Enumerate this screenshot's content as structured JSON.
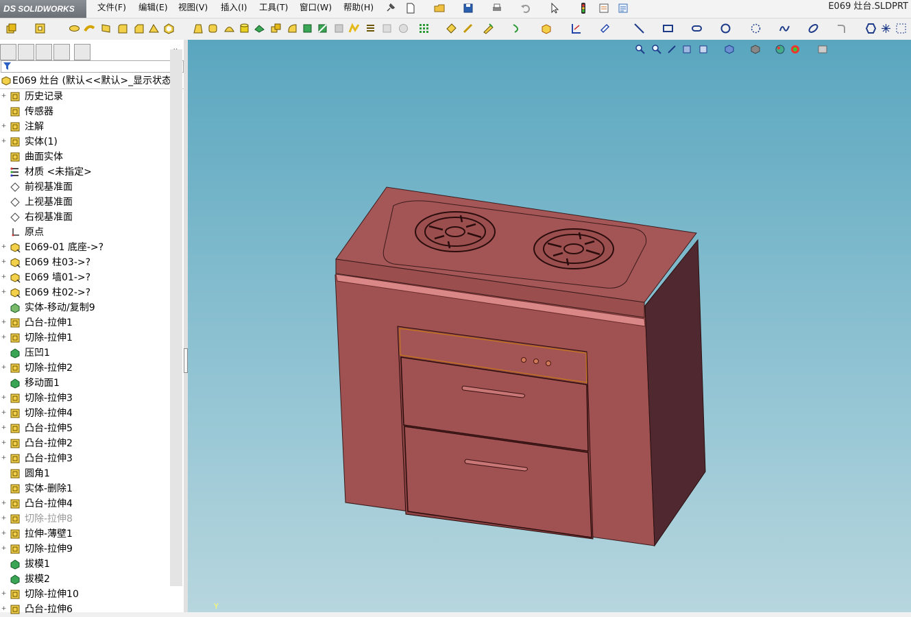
{
  "app": {
    "logo_text": "SOLIDWORKS",
    "logo_prefix": "DS",
    "filename": "E069 灶台.SLDPRT"
  },
  "menu": [
    "文件(F)",
    "编辑(E)",
    "视图(V)",
    "插入(I)",
    "工具(T)",
    "窗口(W)",
    "帮助(H)"
  ],
  "panel": {
    "tab_icons": [
      "feature-manager-icon",
      "property-manager-icon",
      "configuration-manager-icon",
      "dimxpert-icon",
      "display-manager-icon"
    ],
    "collapse_label": "»",
    "root_label": "E069 灶台  (默认<<默认>_显示状态"
  },
  "tree": [
    {
      "label": "历史记录",
      "icon": "history-icon",
      "expand": true
    },
    {
      "label": "传感器",
      "icon": "sensor-icon",
      "expand": false
    },
    {
      "label": "注解",
      "icon": "annotation-icon",
      "expand": true
    },
    {
      "label": "实体(1)",
      "icon": "solid-body-icon",
      "expand": true
    },
    {
      "label": "曲面实体",
      "icon": "surface-body-icon",
      "expand": false
    },
    {
      "label": "材质 <未指定>",
      "icon": "material-icon",
      "expand": false
    },
    {
      "label": "前视基准面",
      "icon": "plane-icon",
      "expand": false
    },
    {
      "label": "上视基准面",
      "icon": "plane-icon",
      "expand": false
    },
    {
      "label": "右视基准面",
      "icon": "plane-icon",
      "expand": false
    },
    {
      "label": "原点",
      "icon": "origin-icon",
      "expand": false
    },
    {
      "label": "E069-01 底座->?",
      "icon": "derived-part-icon",
      "expand": true
    },
    {
      "label": "E069 柱03->?",
      "icon": "derived-part-icon",
      "expand": true
    },
    {
      "label": "E069 墙01->?",
      "icon": "derived-part-icon",
      "expand": true
    },
    {
      "label": "E069 柱02->?",
      "icon": "derived-part-icon",
      "expand": true
    },
    {
      "label": "实体-移动/复制9",
      "icon": "move-copy-icon",
      "expand": false
    },
    {
      "label": "凸台-拉伸1",
      "icon": "boss-extrude-icon",
      "expand": true
    },
    {
      "label": "切除-拉伸1",
      "icon": "cut-extrude-icon",
      "expand": true
    },
    {
      "label": "压凹1",
      "icon": "indent-icon",
      "expand": false
    },
    {
      "label": "切除-拉伸2",
      "icon": "cut-extrude-icon",
      "expand": true
    },
    {
      "label": "移动面1",
      "icon": "move-face-icon",
      "expand": false
    },
    {
      "label": "切除-拉伸3",
      "icon": "cut-extrude-icon",
      "expand": true
    },
    {
      "label": "切除-拉伸4",
      "icon": "cut-extrude-icon",
      "expand": true
    },
    {
      "label": "凸台-拉伸5",
      "icon": "boss-extrude-icon",
      "expand": true
    },
    {
      "label": "凸台-拉伸2",
      "icon": "boss-extrude-icon",
      "expand": true
    },
    {
      "label": "凸台-拉伸3",
      "icon": "boss-extrude-icon",
      "expand": true
    },
    {
      "label": "圆角1",
      "icon": "fillet-icon",
      "expand": false
    },
    {
      "label": "实体-删除1",
      "icon": "delete-body-icon",
      "expand": false
    },
    {
      "label": "凸台-拉伸4",
      "icon": "boss-extrude-icon",
      "expand": true
    },
    {
      "label": "切除-拉伸8",
      "icon": "cut-extrude-icon",
      "expand": true,
      "dim": true
    },
    {
      "label": "拉伸-薄壁1",
      "icon": "thin-extrude-icon",
      "expand": true
    },
    {
      "label": "切除-拉伸9",
      "icon": "cut-extrude-icon",
      "expand": true
    },
    {
      "label": "拔模1",
      "icon": "draft-icon",
      "expand": false
    },
    {
      "label": "拔模2",
      "icon": "draft-icon",
      "expand": false
    },
    {
      "label": "切除-拉伸10",
      "icon": "cut-extrude-icon",
      "expand": true
    },
    {
      "label": "凸台-拉伸6",
      "icon": "boss-extrude-icon",
      "expand": true
    }
  ],
  "viewport": {
    "axis_label": "Y",
    "model_color": "#a05252",
    "model_side_color": "#502830",
    "background_top": "#5aa6bf",
    "background_bottom": "#b7d6de"
  }
}
